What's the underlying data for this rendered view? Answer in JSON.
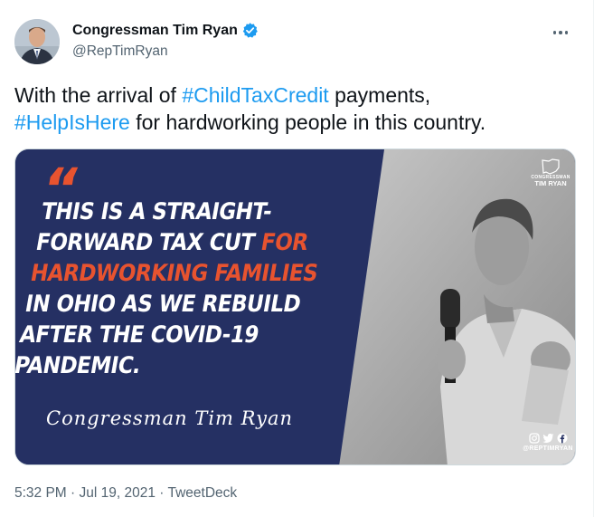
{
  "author": {
    "display_name": "Congressman Tim Ryan",
    "handle": "@RepTimRyan",
    "verified": true
  },
  "icons": {
    "verified": "verified-badge-icon",
    "more": "more-horizontal-icon",
    "instagram": "instagram-icon",
    "twitter": "twitter-icon",
    "facebook": "facebook-icon",
    "ohio_outline": "ohio-map-icon"
  },
  "tweet": {
    "text_pre": "With the arrival of ",
    "hashtag_1": "#ChildTaxCredit",
    "text_mid": " payments,",
    "hashtag_2": "#HelpIsHere",
    "text_post": " for hardworking people in this country."
  },
  "media": {
    "quote_mark": "“",
    "lines": [
      {
        "text": "THIS IS A STRAIGHT-",
        "accent": ""
      },
      {
        "text": "FORWARD TAX CUT ",
        "accent": "FOR"
      },
      {
        "text": "",
        "accent": "HARDWORKING FAMILIES"
      },
      {
        "text": "IN OHIO AS WE REBUILD",
        "accent": ""
      },
      {
        "text": "AFTER THE COVID-19",
        "accent": ""
      },
      {
        "text": "PANDEMIC.",
        "accent": ""
      }
    ],
    "signature": "Congressman Tim Ryan",
    "logo_sub": "CONGRESSMAN",
    "logo_main": "TIM RYAN",
    "social_handle": "@REPTIMRYAN"
  },
  "meta": {
    "time": "5:32 PM",
    "separator": " · ",
    "date": "Jul 19, 2021",
    "source": "TweetDeck"
  },
  "colors": {
    "accent_blue": "#1d9bf0",
    "navy": "#253063",
    "quote_orange": "#e8532f",
    "secondary_text": "#536471"
  }
}
